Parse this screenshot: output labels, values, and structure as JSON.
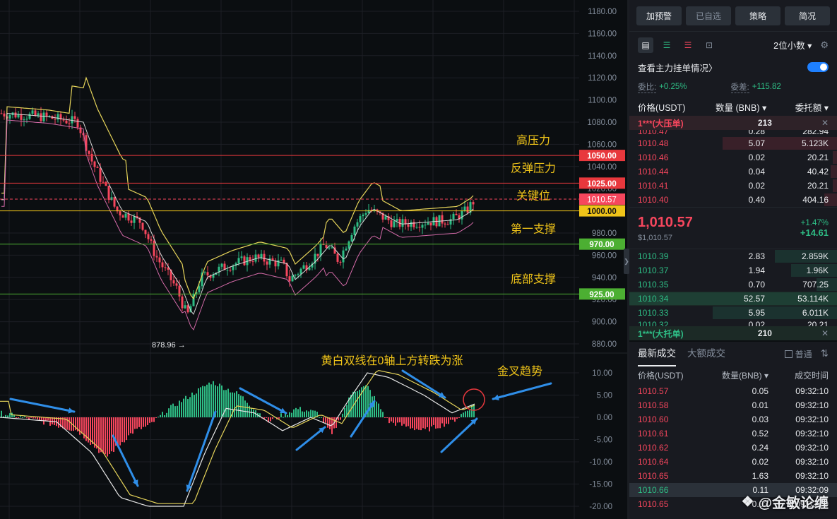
{
  "chart": {
    "price_axis_labels": [
      "1180.00",
      "1160.00",
      "1140.00",
      "1120.00",
      "1100.00",
      "1080.00",
      "1060.00",
      "1040.00",
      "1020.00",
      "980.00",
      "960.00",
      "940.00",
      "920.00",
      "900.00",
      "880.00"
    ],
    "macd_axis_labels": [
      "10.00",
      "5.00",
      "0.00",
      "-5.00",
      "-10.00",
      "-15.00",
      "-20.00"
    ],
    "levels": [
      {
        "label": "高压力",
        "price": "1050.00",
        "tag_color": "#e8383d",
        "line_color": "#e8383d"
      },
      {
        "label": "反弹压力",
        "price": "1025.00",
        "tag_color": "#e8383d",
        "line_color": "#e8383d"
      },
      {
        "label": "关键位",
        "price": "1000.00",
        "tag_color": "#f0c419",
        "line_color": "#f0c419"
      },
      {
        "label": "第一支撑",
        "price": "970.00",
        "tag_color": "#4caf32",
        "line_color": "#4caf32"
      },
      {
        "label": "底部支撑",
        "price": "925.00",
        "tag_color": "#4caf32",
        "line_color": "#4caf32"
      }
    ],
    "current_price_tag": "1010.57",
    "low_marker": "878.96 →",
    "annotation_macd": "黄白双线在0轴上方转跌为涨",
    "annotation_cross": "金叉趋势",
    "label_color": "#f0c419"
  },
  "panel": {
    "buttons": [
      "加预警",
      "已自选",
      "策略",
      "简况"
    ],
    "decimals": "2位小数 ▾",
    "settings_icon": "⚙",
    "main_orders": "查看主力挂单情况〉",
    "ratio_label": "委比:",
    "ratio_value": "+0.25%",
    "diff_label": "委差:",
    "diff_value": "+115.82",
    "ob_headers": [
      "价格(USDT)",
      "数量 (BNB) ▾",
      "委托额 ▾"
    ],
    "big_ask": {
      "label": "1***(大压单)",
      "qty": "213",
      "close": "✕"
    },
    "asks_partial": {
      "price": "1010.47",
      "qty": "0.28",
      "amount": "282.94"
    },
    "asks": [
      {
        "price": "1010.48",
        "qty": "5.07",
        "amount": "5.123K",
        "depth": 0.55
      },
      {
        "price": "1010.46",
        "qty": "0.02",
        "amount": "20.21",
        "depth": 0.02
      },
      {
        "price": "1010.44",
        "qty": "0.04",
        "amount": "40.42",
        "depth": 0.03
      },
      {
        "price": "1010.41",
        "qty": "0.02",
        "amount": "20.21",
        "depth": 0.02
      },
      {
        "price": "1010.40",
        "qty": "0.40",
        "amount": "404.16",
        "depth": 0.06
      }
    ],
    "mid_price": "1,010.57",
    "mid_usd": "$1,010.57",
    "change_pct": "+1.47%",
    "change_abs": "+14.61",
    "bids": [
      {
        "price": "1010.39",
        "qty": "2.83",
        "amount": "2.859K",
        "depth": 0.3
      },
      {
        "price": "1010.37",
        "qty": "1.94",
        "amount": "1.96K",
        "depth": 0.22
      },
      {
        "price": "1010.35",
        "qty": "0.70",
        "amount": "707.25",
        "depth": 0.1
      },
      {
        "price": "1010.34",
        "qty": "52.57",
        "amount": "53.114K",
        "depth": 1.0
      },
      {
        "price": "1010.33",
        "qty": "5.95",
        "amount": "6.011K",
        "depth": 0.6
      }
    ],
    "bids_partial": {
      "price": "1010.32",
      "qty": "0.02",
      "amount": "20.21"
    },
    "big_bid": {
      "label": "1***(大托单)",
      "qty": "210",
      "close": "✕"
    },
    "trade_tabs": [
      "最新成交",
      "大额成交"
    ],
    "normal_label": "普通",
    "trade_headers": [
      "价格(USDT)",
      "数量(BNB) ▾",
      "成交时间"
    ],
    "trades": [
      {
        "price": "1010.57",
        "qty": "0.05",
        "time": "09:32:10",
        "side": "sell"
      },
      {
        "price": "1010.58",
        "qty": "0.01",
        "time": "09:32:10",
        "side": "sell"
      },
      {
        "price": "1010.60",
        "qty": "0.03",
        "time": "09:32:10",
        "side": "sell"
      },
      {
        "price": "1010.61",
        "qty": "0.52",
        "time": "09:32:10",
        "side": "sell"
      },
      {
        "price": "1010.62",
        "qty": "0.24",
        "time": "09:32:10",
        "side": "sell"
      },
      {
        "price": "1010.64",
        "qty": "0.02",
        "time": "09:32:10",
        "side": "sell"
      },
      {
        "price": "1010.65",
        "qty": "1.63",
        "time": "09:32:10",
        "side": "sell"
      },
      {
        "price": "1010.66",
        "qty": "0.11",
        "time": "09:32:09",
        "side": "buy"
      },
      {
        "price": "1010.65",
        "qty": "0.03",
        "time": "09:32:09",
        "side": "sell"
      }
    ],
    "watermark": "@金敏论缠"
  }
}
